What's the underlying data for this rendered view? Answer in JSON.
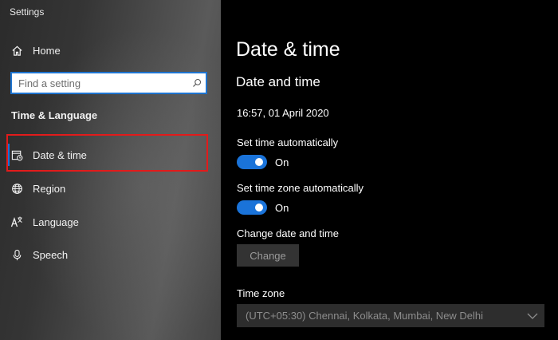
{
  "window": {
    "title": "Settings"
  },
  "sidebar": {
    "home_label": "Home",
    "search_placeholder": "Find a setting",
    "section_heading": "Time & Language",
    "items": [
      {
        "label": "Date & time",
        "icon": "calendar-clock-icon",
        "selected": true
      },
      {
        "label": "Region",
        "icon": "globe-icon",
        "selected": false
      },
      {
        "label": "Language",
        "icon": "language-icon",
        "selected": false
      },
      {
        "label": "Speech",
        "icon": "microphone-icon",
        "selected": false
      }
    ]
  },
  "main": {
    "page_title": "Date & time",
    "section_title": "Date and time",
    "current_datetime": "16:57, 01 April 2020",
    "set_time_auto": {
      "label": "Set time automatically",
      "state": "On",
      "on": true
    },
    "set_timezone_auto": {
      "label": "Set time zone automatically",
      "state": "On",
      "on": true
    },
    "change_date": {
      "label": "Change date and time",
      "button": "Change"
    },
    "time_zone": {
      "label": "Time zone",
      "value": "(UTC+05:30) Chennai, Kolkata, Mumbai, New Delhi"
    }
  },
  "colors": {
    "accent": "#1a73d9",
    "highlight_outline": "#e21b1b"
  }
}
